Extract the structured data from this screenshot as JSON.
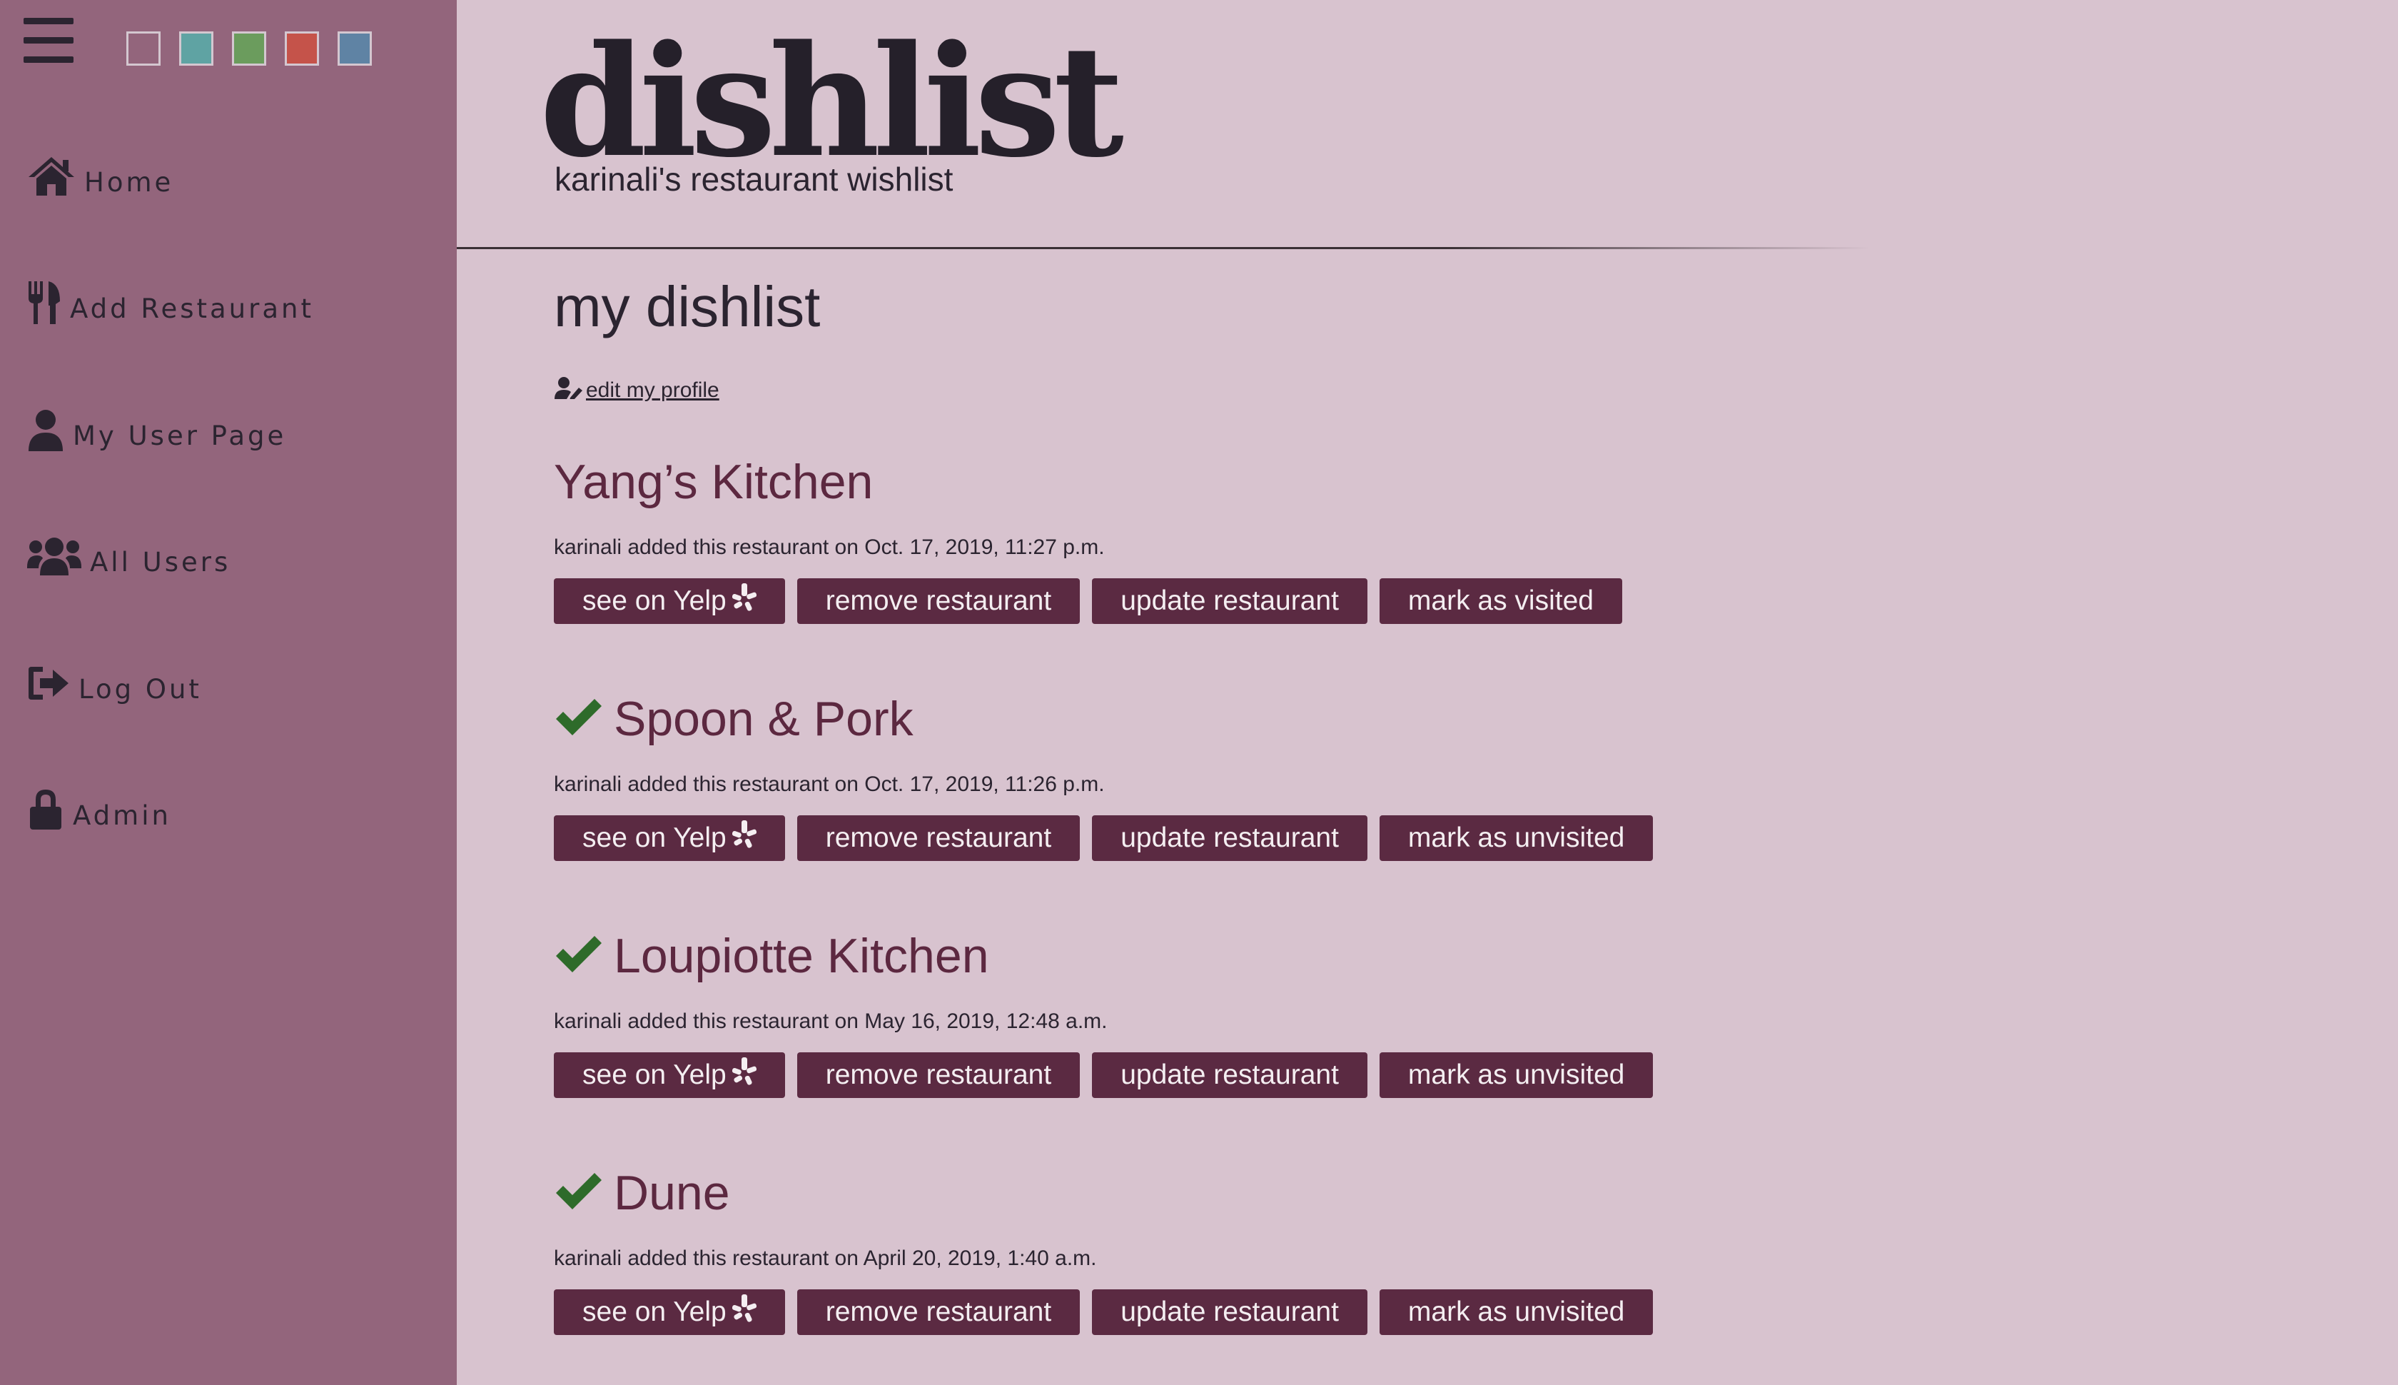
{
  "sidebar": {
    "swatch_colors": [
      "#93657c",
      "#5fa3a3",
      "#6b9c5d",
      "#c5534a",
      "#5f83a4"
    ],
    "items": [
      {
        "label": "Home",
        "icon": "home-icon"
      },
      {
        "label": "Add Restaurant",
        "icon": "utensils-icon"
      },
      {
        "label": "My User Page",
        "icon": "user-icon"
      },
      {
        "label": "All Users",
        "icon": "users-icon"
      },
      {
        "label": "Log Out",
        "icon": "sign-out-icon"
      },
      {
        "label": "Admin",
        "icon": "lock-icon"
      }
    ]
  },
  "header": {
    "logo": "dishlist",
    "tagline": "karinali's restaurant wishlist"
  },
  "main": {
    "title": "my dishlist",
    "edit_profile": " edit my profile",
    "restaurants": [
      {
        "name": "Yang’s Kitchen",
        "visited": false,
        "meta": "karinali added this restaurant on Oct. 17, 2019, 11:27 p.m.",
        "yelp": "see on Yelp",
        "remove": "remove restaurant",
        "update": "update restaurant",
        "mark": "mark as visited"
      },
      {
        "name": "Spoon & Pork",
        "visited": true,
        "meta": "karinali added this restaurant on Oct. 17, 2019, 11:26 p.m.",
        "yelp": "see on Yelp",
        "remove": "remove restaurant",
        "update": "update restaurant",
        "mark": "mark as unvisited"
      },
      {
        "name": "Loupiotte Kitchen",
        "visited": true,
        "meta": "karinali added this restaurant on May 16, 2019, 12:48 a.m.",
        "yelp": "see on Yelp",
        "remove": "remove restaurant",
        "update": "update restaurant",
        "mark": "mark as unvisited"
      },
      {
        "name": "Dune",
        "visited": true,
        "meta": "karinali added this restaurant on April 20, 2019, 1:40 a.m.",
        "yelp": "see on Yelp",
        "remove": "remove restaurant",
        "update": "update restaurant",
        "mark": "mark as unvisited"
      }
    ]
  }
}
